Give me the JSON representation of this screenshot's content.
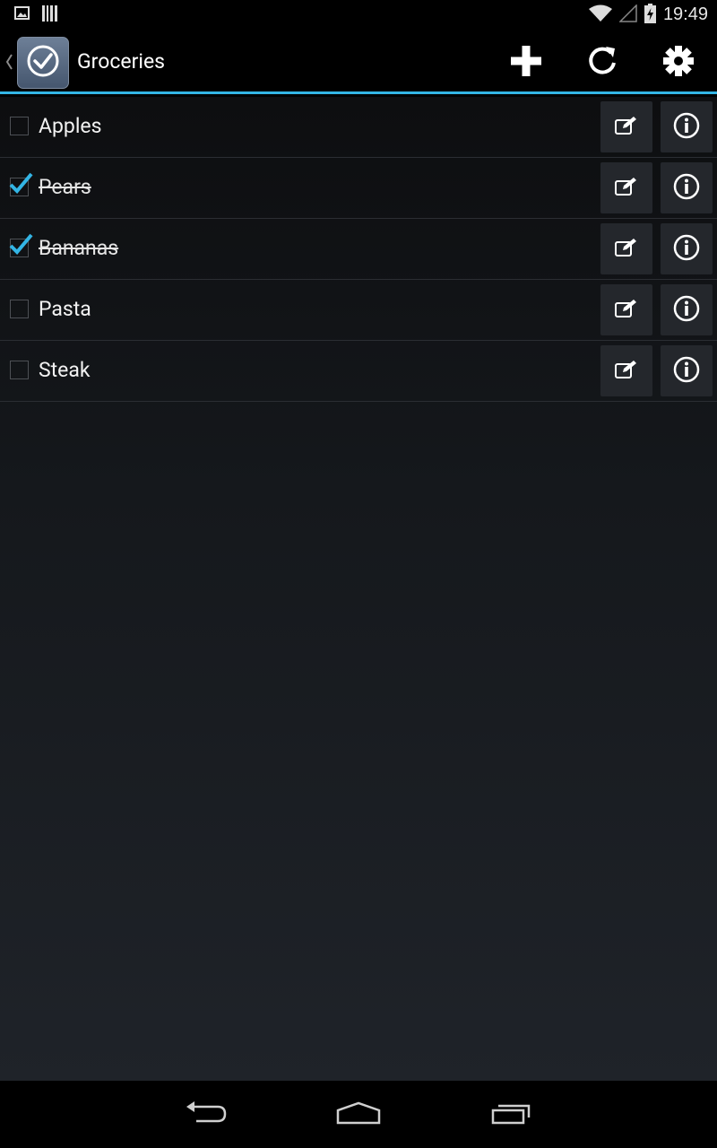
{
  "status_bar": {
    "time": "19:49",
    "icons": [
      "picture-notification-icon",
      "barcode-notification-icon",
      "wifi-icon",
      "signal-icon",
      "battery-charging-icon"
    ]
  },
  "action_bar": {
    "title": "Groceries",
    "actions": [
      "add-icon",
      "refresh-icon",
      "settings-icon"
    ]
  },
  "list": {
    "items": [
      {
        "label": "Apples",
        "checked": false
      },
      {
        "label": "Pears",
        "checked": true
      },
      {
        "label": "Bananas",
        "checked": true
      },
      {
        "label": "Pasta",
        "checked": false
      },
      {
        "label": "Steak",
        "checked": false
      }
    ]
  },
  "nav_bar": {
    "buttons": [
      "back-icon",
      "home-icon",
      "recent-apps-icon"
    ]
  },
  "colors": {
    "accent": "#33b5e5",
    "checkmark": "#33b5e5",
    "button_bg": "#24272c"
  }
}
